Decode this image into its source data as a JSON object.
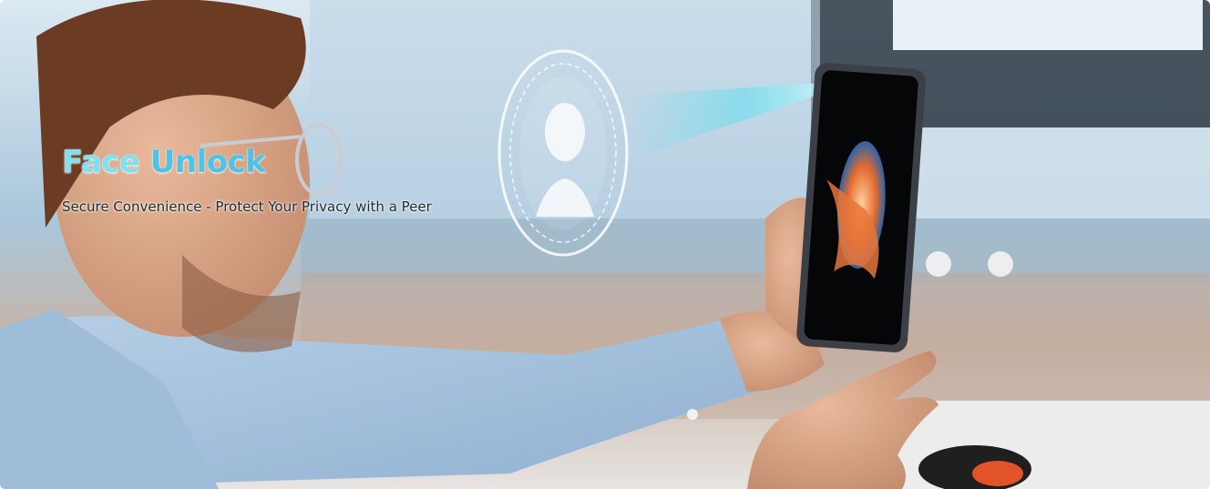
{
  "hero": {
    "title_word1": "Face",
    "title_word2": "Unlock",
    "subtitle": "Secure Convenience - Protect Your Privacy with a Peer"
  },
  "colors": {
    "title_light": "#7fe0ef",
    "title_blue": "#4fc3e6",
    "subtitle": "#1e2a33",
    "shirt": "#a8c4de",
    "beam": "#3fd6e8"
  },
  "icons": [
    "face-scan-icon",
    "user-silhouette-icon"
  ]
}
